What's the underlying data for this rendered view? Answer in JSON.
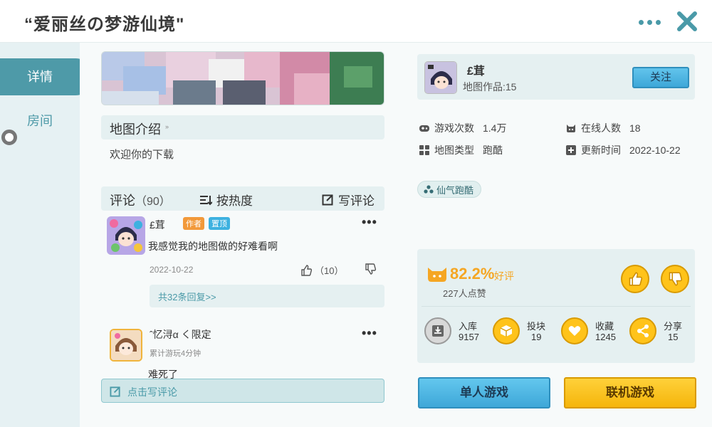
{
  "header": {
    "title": "“爱丽丝の梦游仙境\""
  },
  "sidebar": {
    "tabs": [
      {
        "label": "详情"
      },
      {
        "label": "房间"
      }
    ]
  },
  "intro": {
    "title": "地图介绍",
    "arrow": "»",
    "text": "欢迎你的下载"
  },
  "comments": {
    "title": "评论",
    "count": "（90）",
    "sort_label": "按热度",
    "write_label": "写评论",
    "items": [
      {
        "name": "£茸",
        "tag_author": "作者",
        "tag_top": "置顶",
        "text": "我感觉我的地图做的好难看啊",
        "date": "2022-10-22",
        "likes": "（10）",
        "replies": "共32条回复>>"
      },
      {
        "name": "ˆ忆浔α く限定",
        "sub": "累计游玩4分钟",
        "text": "难死了"
      }
    ],
    "write_placeholder": "点击写评论"
  },
  "author": {
    "name": "£茸",
    "works": "地图作品:15",
    "follow_label": "关注"
  },
  "stats": {
    "plays_label": "游戏次数",
    "plays": "1.4万",
    "online_label": "在线人数",
    "online": "18",
    "type_label": "地图类型",
    "type": "跑酷",
    "updated_label": "更新时间",
    "updated": "2022-10-22"
  },
  "tag_chip": "仙气跑酷",
  "rating": {
    "percent": "82.2%",
    "label": "好评",
    "count": "227人点赞"
  },
  "actions": [
    {
      "label": "入库",
      "value": "9157"
    },
    {
      "label": "投块",
      "value": "19"
    },
    {
      "label": "收藏",
      "value": "1245"
    },
    {
      "label": "分享",
      "value": "15"
    }
  ],
  "buttons": {
    "single": "单人游戏",
    "multi": "联机游戏"
  },
  "colors": {
    "accent": "#4e9aa8",
    "orange": "#f5a623",
    "blue_btn": "#3ea7d8",
    "yellow_btn": "#f5b50b"
  }
}
